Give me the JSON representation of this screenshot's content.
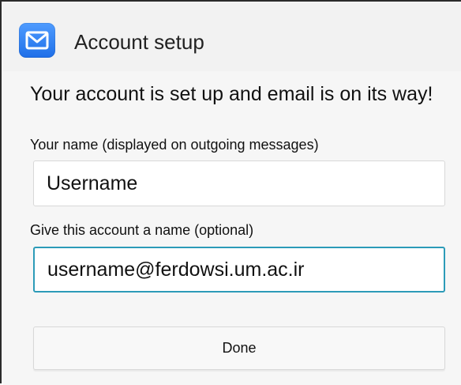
{
  "header": {
    "title": "Account setup",
    "icon": "email-icon"
  },
  "main": {
    "message": "Your account is set up and email is on its way!",
    "name_label": "Your name (displayed on outgoing messages)",
    "name_value": "Username",
    "account_label": "Give this account a name (optional)",
    "account_value": "username@ferdowsi.um.ac.ir",
    "done_label": "Done"
  },
  "colors": {
    "accent": "#2c9bb8",
    "icon_blue": "#1f6fe8"
  }
}
